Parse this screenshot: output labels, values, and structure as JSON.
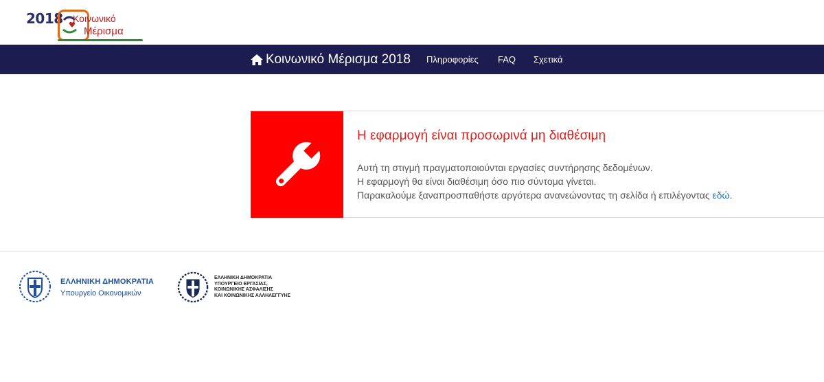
{
  "logo": {
    "year": "2018",
    "line1": "Κοινωνικό",
    "line2": "Μέρισμα"
  },
  "nav": {
    "home_label": "Κοινωνικό Μέρισμα 2018",
    "links": [
      "Πληροφορίες",
      "FAQ",
      "Σχετικά"
    ]
  },
  "message": {
    "title": "Η εφαρμογή είναι προσωρινά μη διαθέσιμη",
    "line1": "Αυτή τη στιγμή πραγματοποιούνται εργασίες συντήρησης δεδομένων.",
    "line2": "Η εφαρμογή θα είναι διαθέσιμη όσο πιο σύντομα γίνεται.",
    "line3_prefix": "Παρακαλούμε ξαναπροσπαθήστε αργότερα ανανεώνοντας τη σελίδα ή επιλέγοντας ",
    "line3_link": "εδώ",
    "line3_suffix": "."
  },
  "footer": {
    "ministry1": {
      "title": "ΕΛΛΗΝΙΚΗ ΔΗΜΟΚΡΑΤΙΑ",
      "subtitle": "Υπουργείο Οικονομικών"
    },
    "ministry2": {
      "lines": [
        "ΕΛΛΗΝΙΚΗ ΔΗΜΟΚΡΑΤΙΑ",
        "ΥΠΟΥΡΓΕΙΟ ΕΡΓΑΣΙΑΣ,",
        "ΚΟΙΝΩΝΙΚΗΣ ΑΣΦΑΛΙΣΗΣ",
        "ΚΑΙ ΚΟΙΝΩΝΙΚΗΣ ΑΛΛΗΛΕΓΓΥΗΣ"
      ]
    }
  },
  "colors": {
    "navbar": "#1c1c50",
    "alert": "#ff0000",
    "title": "#e0201e",
    "link": "#2a6fb0"
  },
  "icons": {
    "home": "home-icon",
    "alert": "wrench-icon",
    "seal": "greek-coat-of-arms-icon"
  }
}
